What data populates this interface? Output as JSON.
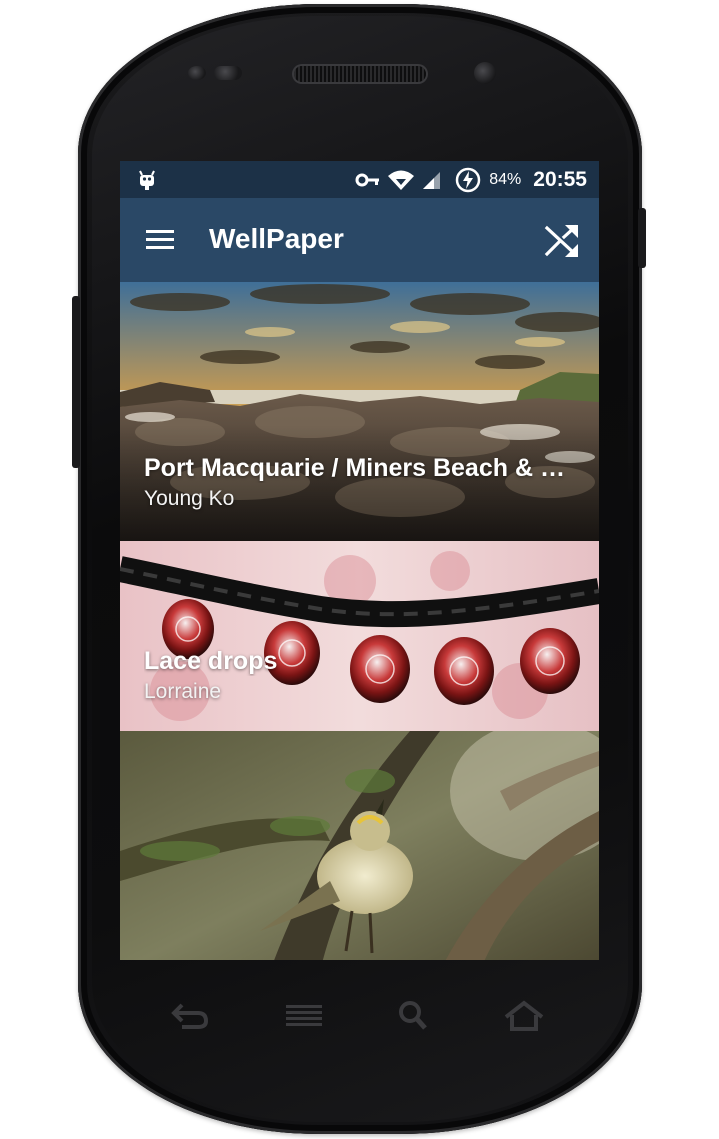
{
  "status_bar": {
    "battery": "84%",
    "time": "20:55",
    "icons": [
      "android-debug-icon",
      "vpn-key-icon",
      "wifi-icon",
      "cell-signal-icon",
      "charging-icon"
    ]
  },
  "app_bar": {
    "title": "WellPaper",
    "menu_icon": "menu-icon",
    "shuffle_icon": "shuffle-icon"
  },
  "wallpapers": [
    {
      "title": "Port Macquarie / Miners Beach & Lighthouse Beach",
      "author": "Young Ko"
    },
    {
      "title": "Lace drops",
      "author": "Lorraine"
    },
    {
      "title": "",
      "author": ""
    }
  ],
  "device_nav": [
    "back-icon",
    "menu-icon",
    "search-icon",
    "home-icon"
  ],
  "colors": {
    "status_bar": "#1c3147",
    "app_bar": "#2a4866"
  }
}
